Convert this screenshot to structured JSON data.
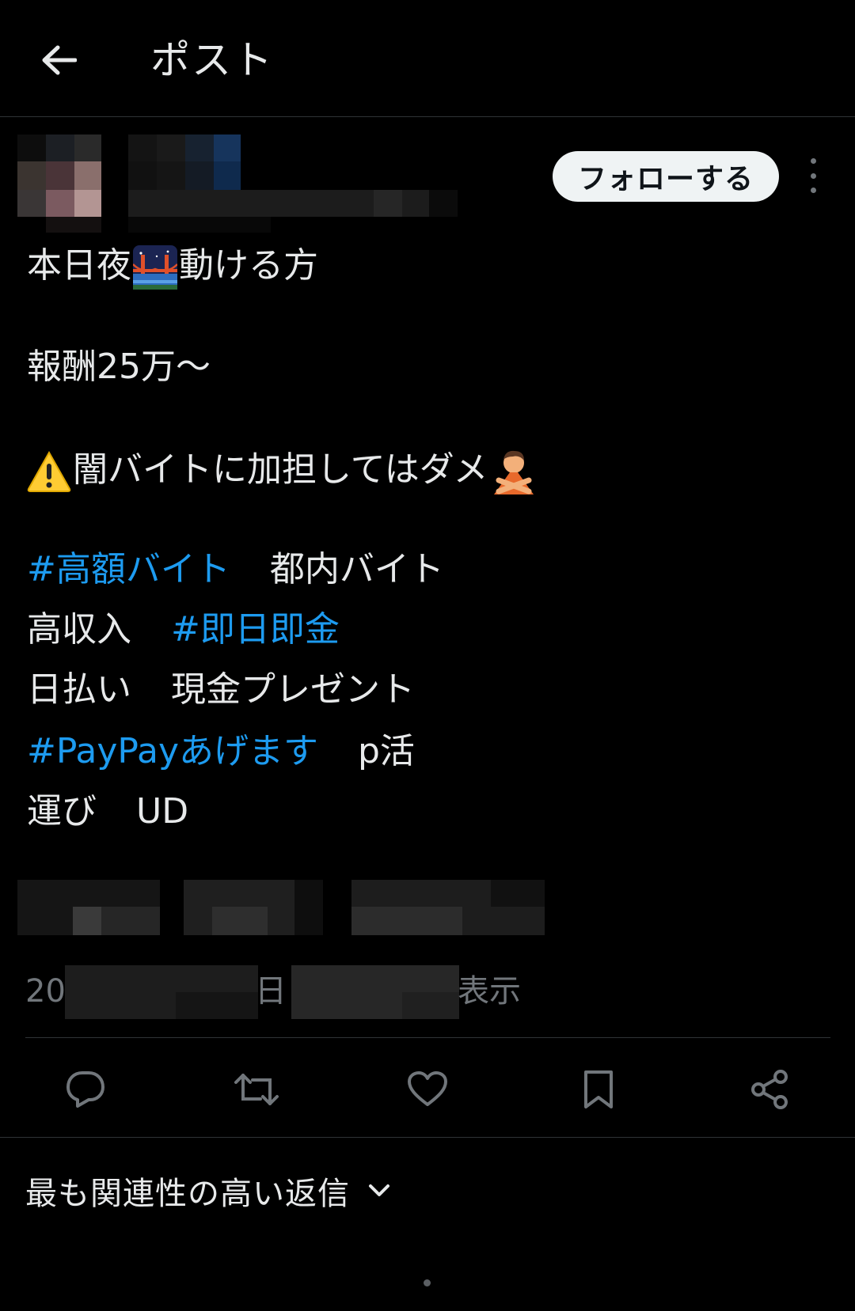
{
  "header": {
    "title": "ポスト",
    "back_icon": "arrow-left-icon"
  },
  "author": {
    "follow_label": "フォローする",
    "more_icon": "more-vertical-icon"
  },
  "post": {
    "line1_a": "本日夜",
    "line1_emoji": "bridge-at-night-emoji",
    "line1_b": "動ける方",
    "line2": "報酬25万〜",
    "line3_emoji": "warning-emoji",
    "line3_text": "闇バイトに加担してはダメ",
    "line3_emoji_end": "person-gesturing-no-emoji",
    "hashtag1": "#高額バイト",
    "text1": "都内バイト",
    "text2": "高収入",
    "hashtag2": "#即日即金",
    "text3": "日払い",
    "text4": "現金プレゼント",
    "hashtag3": "#PayPayあげます",
    "text5": "p活",
    "text6": "運び",
    "text7": "UD"
  },
  "meta": {
    "prefix": "20",
    "day_char": "日",
    "views_suffix": "表示"
  },
  "actions": [
    {
      "name": "reply",
      "icon": "reply-icon"
    },
    {
      "name": "repost",
      "icon": "repost-icon"
    },
    {
      "name": "like",
      "icon": "heart-icon"
    },
    {
      "name": "bookmark",
      "icon": "bookmark-icon"
    },
    {
      "name": "share",
      "icon": "share-icon"
    }
  ],
  "replies": {
    "sort_label": "最も関連性の高い返信",
    "sort_icon": "chevron-down-icon"
  },
  "colors": {
    "background": "#000000",
    "text": "#e7e9ea",
    "secondary": "#71767b",
    "link": "#1d9bf0",
    "divider": "#2f3336",
    "follow_bg": "#eff3f4"
  }
}
